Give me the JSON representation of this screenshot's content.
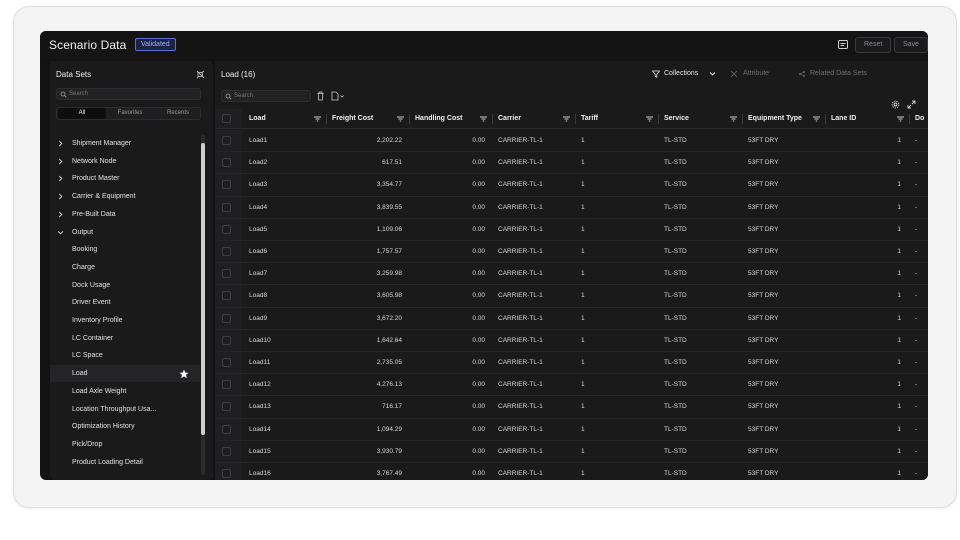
{
  "header": {
    "title": "Scenario Data",
    "badge": "Validated",
    "reset_label": "Reset",
    "save_label": "Save",
    "notes_icon": "notes-icon"
  },
  "sidebar": {
    "title": "Data Sets",
    "search_placeholder": "Search",
    "tabs": [
      "All",
      "Favorites",
      "Recents"
    ],
    "active_tab": "All",
    "items": [
      {
        "label": "Shipment Manager",
        "chevron": "right"
      },
      {
        "label": "Network Node",
        "chevron": "right"
      },
      {
        "label": "Product Master",
        "chevron": "right"
      },
      {
        "label": "Carrier & Equipment",
        "chevron": "right"
      },
      {
        "label": "Pre-Built Data",
        "chevron": "right"
      },
      {
        "label": "Output",
        "chevron": "down"
      },
      {
        "label": "Booking"
      },
      {
        "label": "Charge"
      },
      {
        "label": "Dock Usage"
      },
      {
        "label": "Driver Event"
      },
      {
        "label": "Inventory Profile"
      },
      {
        "label": "LC Container"
      },
      {
        "label": "LC Space"
      },
      {
        "label": "Load",
        "selected": true,
        "starred": true
      },
      {
        "label": "Load Axle Weight"
      },
      {
        "label": "Location Throughput Usa..."
      },
      {
        "label": "Optimization History"
      },
      {
        "label": "Pick/Drop"
      },
      {
        "label": "Product Loading Detail"
      }
    ]
  },
  "main": {
    "title": "Load (16)",
    "search_placeholder": "Search",
    "collections_label": "Collections",
    "attribute_label": "Attribute",
    "related_label": "Related Data Sets",
    "columns": [
      "Load",
      "Freight Cost",
      "Handling Cost",
      "Carrier",
      "Tariff",
      "Service",
      "Equipment Type",
      "Lane ID",
      "Do"
    ],
    "rows": [
      [
        "Load1",
        "2,202.22",
        "0.00",
        "CARRIER-TL-1",
        "1",
        "TL-STD",
        "53FT DRY",
        "1",
        "-"
      ],
      [
        "Load2",
        "617.51",
        "0.00",
        "CARRIER-TL-1",
        "1",
        "TL-STD",
        "53FT DRY",
        "1",
        "-"
      ],
      [
        "Load3",
        "3,354.77",
        "0.00",
        "CARRIER-TL-1",
        "1",
        "TL-STD",
        "53FT DRY",
        "1",
        "-"
      ],
      [
        "Load4",
        "3,839.55",
        "0.00",
        "CARRIER-TL-1",
        "1",
        "TL-STD",
        "53FT DRY",
        "1",
        "-"
      ],
      [
        "Load5",
        "1,109.06",
        "0.00",
        "CARRIER-TL-1",
        "1",
        "TL-STD",
        "53FT DRY",
        "1",
        "-"
      ],
      [
        "Load6",
        "1,757.57",
        "0.00",
        "CARRIER-TL-1",
        "1",
        "TL-STD",
        "53FT DRY",
        "1",
        "-"
      ],
      [
        "Load7",
        "3,259.98",
        "0.00",
        "CARRIER-TL-1",
        "1",
        "TL-STD",
        "53FT DRY",
        "1",
        "-"
      ],
      [
        "Load8",
        "3,605.98",
        "0.00",
        "CARRIER-TL-1",
        "1",
        "TL-STD",
        "53FT DRY",
        "1",
        "-"
      ],
      [
        "Load9",
        "3,672.20",
        "0.00",
        "CARRIER-TL-1",
        "1",
        "TL-STD",
        "53FT DRY",
        "1",
        "-"
      ],
      [
        "Load10",
        "1,642.64",
        "0.00",
        "CARRIER-TL-1",
        "1",
        "TL-STD",
        "53FT DRY",
        "1",
        "-"
      ],
      [
        "Load11",
        "2,735.05",
        "0.00",
        "CARRIER-TL-1",
        "1",
        "TL-STD",
        "53FT DRY",
        "1",
        "-"
      ],
      [
        "Load12",
        "4,276.13",
        "0.00",
        "CARRIER-TL-1",
        "1",
        "TL-STD",
        "53FT DRY",
        "1",
        "-"
      ],
      [
        "Load13",
        "716.17",
        "0.00",
        "CARRIER-TL-1",
        "1",
        "TL-STD",
        "53FT DRY",
        "1",
        "-"
      ],
      [
        "Load14",
        "1,094.29",
        "0.00",
        "CARRIER-TL-1",
        "1",
        "TL-STD",
        "53FT DRY",
        "1",
        "-"
      ],
      [
        "Load15",
        "3,930.79",
        "0.00",
        "CARRIER-TL-1",
        "1",
        "TL-STD",
        "53FT DRY",
        "1",
        "-"
      ],
      [
        "Load16",
        "3,767.49",
        "0.00",
        "CARRIER-TL-1",
        "1",
        "TL-STD",
        "53FT DRY",
        "1",
        "-"
      ]
    ]
  }
}
